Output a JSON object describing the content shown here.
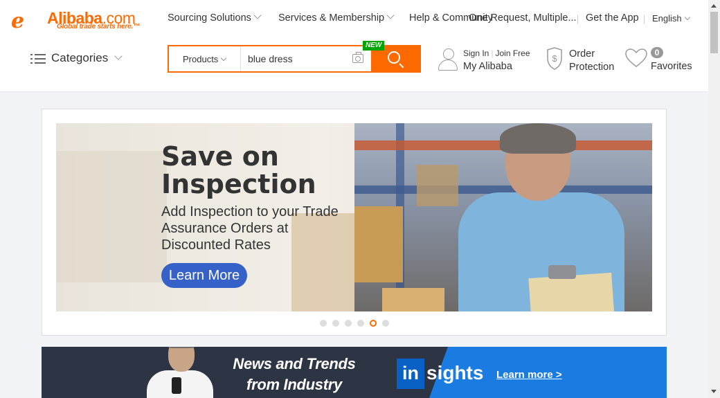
{
  "logo": {
    "mark": "e",
    "brand": "Alibaba",
    "domain": ".com",
    "tagline": "Global trade starts here.™"
  },
  "topnav": {
    "sourcing": "Sourcing Solutions",
    "services": "Services & Membership",
    "help": "Help & Community",
    "rfq": "One Request, Multiple...",
    "app": "Get the App",
    "language": "English"
  },
  "categories": {
    "label": "Categories"
  },
  "search": {
    "category": "Products",
    "value": "blue dress",
    "new_badge": "NEW"
  },
  "account": {
    "sign_in": "Sign In",
    "join": "Join Free",
    "my_alibaba": "My Alibaba"
  },
  "order_protection": {
    "line1": "Order",
    "line2": "Protection"
  },
  "favorites": {
    "count": "0",
    "label": "Favorites"
  },
  "banner": {
    "title": "Save on Inspection",
    "subtitle": "Add Inspection to your Trade Assurance Orders at Discounted Rates",
    "cta": "Learn More",
    "slides": 6,
    "active_slide": 5
  },
  "insights": {
    "headline": "News and Trends from Industry Experts",
    "logo_in": "in",
    "logo_sights": "sights",
    "cta": "Learn more >"
  },
  "colors": {
    "brand": "#ff6a00",
    "cta_blue": "#3661c9",
    "new_green": "#00a400",
    "insights_blue": "#1a7be0"
  }
}
